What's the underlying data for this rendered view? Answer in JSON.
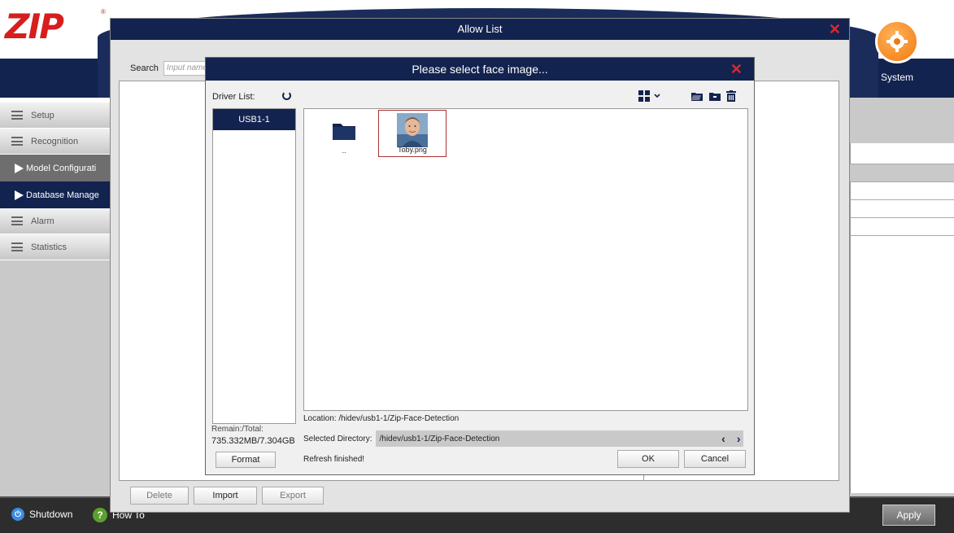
{
  "app": {
    "logo_text": "ZIP",
    "logo_mark": "®",
    "system_label": "System"
  },
  "sidebar": {
    "items": [
      {
        "label": "Setup",
        "type": "section"
      },
      {
        "label": "Recognition",
        "type": "section"
      },
      {
        "label": "Model Configurati",
        "type": "sub"
      },
      {
        "label": "Database Manage",
        "type": "sub-active"
      },
      {
        "label": "Alarm",
        "type": "section"
      },
      {
        "label": "Statistics",
        "type": "section"
      }
    ]
  },
  "allow_list": {
    "title": "Allow List",
    "search_label": "Search",
    "search_placeholder": "Input name",
    "buttons": {
      "delete": "Delete",
      "import": "Import",
      "export": "Export"
    }
  },
  "face_dialog": {
    "title": "Please select face image...",
    "driver_label": "Driver List:",
    "drivers": [
      "USB1-1"
    ],
    "remain_label": "Remain:/Total:",
    "remain_value": "735.332MB/7.304GB",
    "format_label": "Format",
    "files": [
      {
        "name": "..",
        "kind": "folder"
      },
      {
        "name": "Toby.png",
        "kind": "image"
      }
    ],
    "location_text": "Location: /hidev/usb1-1/Zip-Face-Detection",
    "selected_dir_label": "Selected Directory:",
    "selected_dir_value": "/hidev/usb1-1/Zip-Face-Detection",
    "status_text": "Refresh finished!",
    "ok_label": "OK",
    "cancel_label": "Cancel"
  },
  "bottom": {
    "shutdown_label": "Shutdown",
    "howto_label": "How To",
    "apply_label": "Apply"
  },
  "colors": {
    "navy": "#13234f",
    "close_red": "#e4252b",
    "system_orange": "#f07a10"
  }
}
